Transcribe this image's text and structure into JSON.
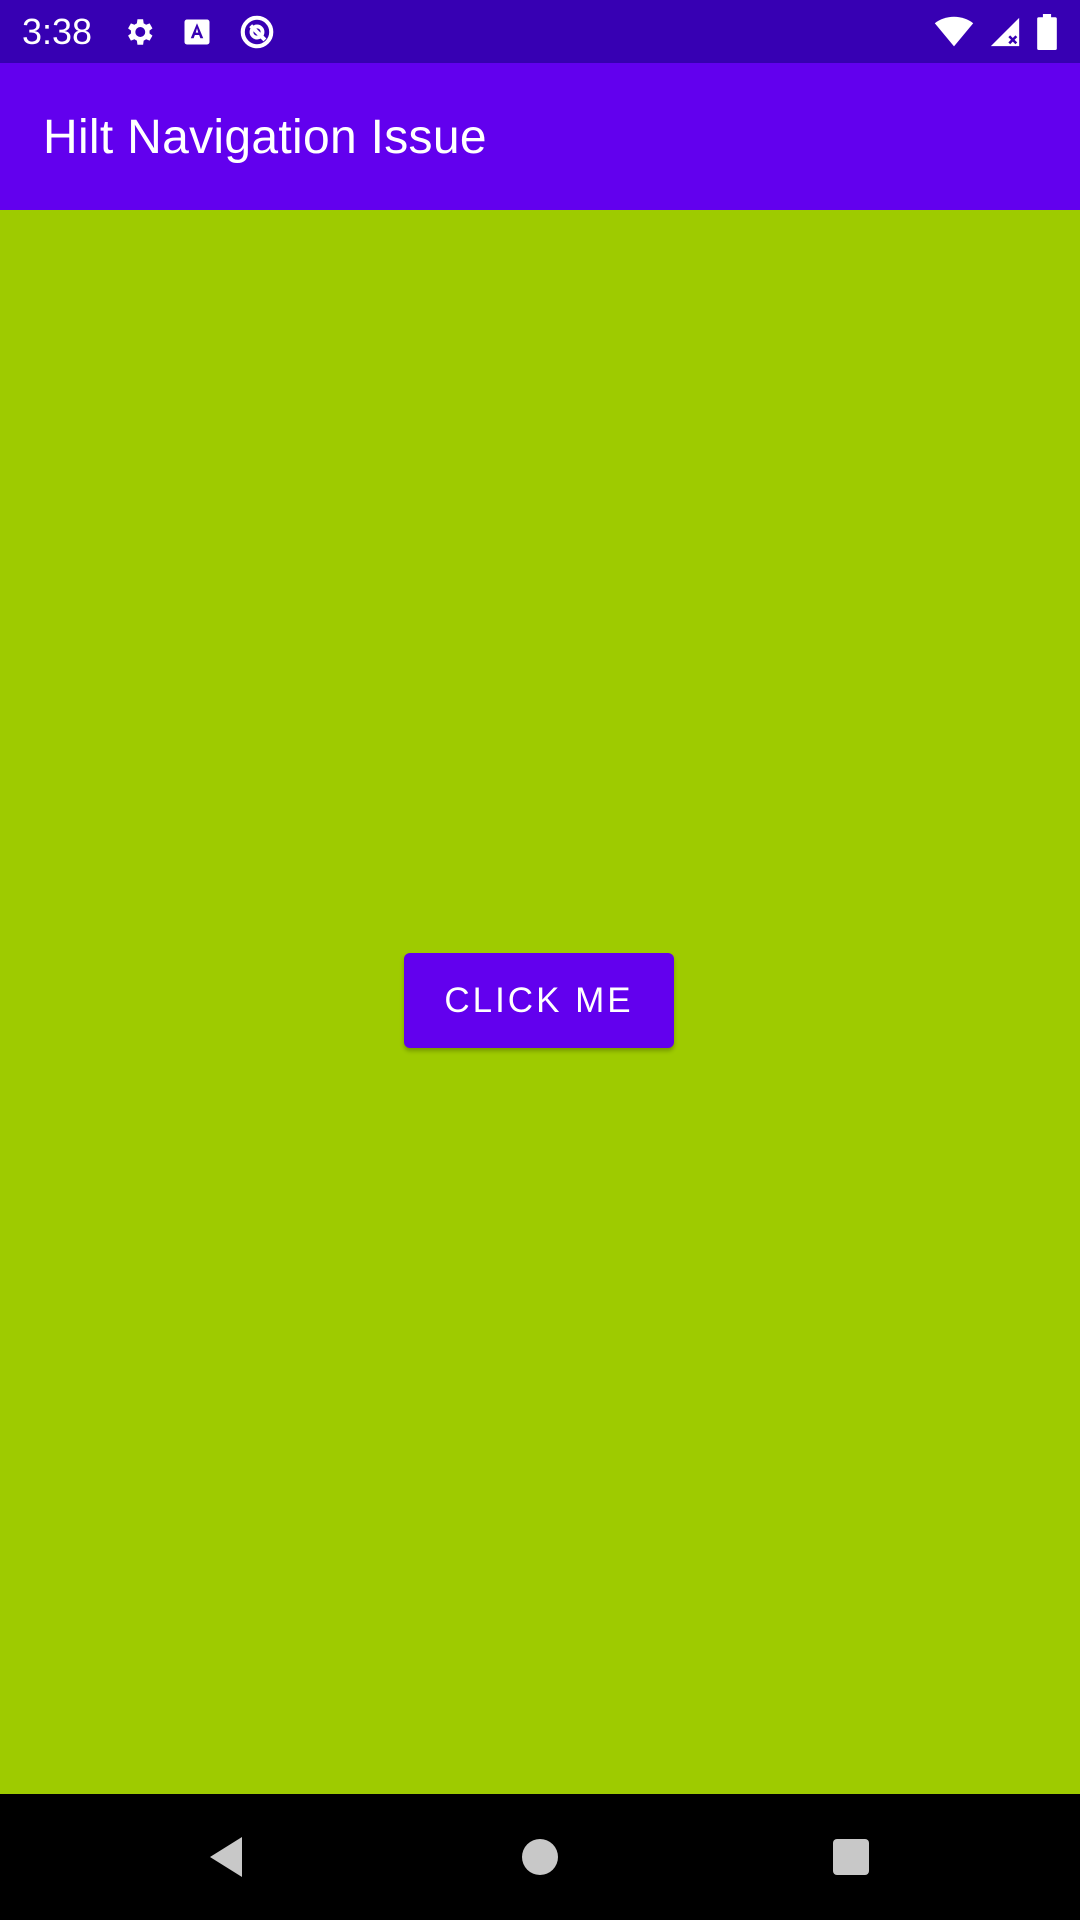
{
  "status_bar": {
    "time": "3:38",
    "left_icons": [
      "gear-icon",
      "text-accessibility-icon",
      "data-saver-icon"
    ],
    "right_icons": [
      "wifi-icon",
      "signal-icon",
      "battery-icon"
    ],
    "color": "#3700b3"
  },
  "app_bar": {
    "title": "Hilt Navigation Issue",
    "color": "#6200ee"
  },
  "main": {
    "background": "#9ecb00",
    "button_label": "Click me"
  },
  "nav_bar": {
    "buttons": [
      "back-icon",
      "home-icon",
      "recents-icon"
    ],
    "color": "#000000"
  }
}
